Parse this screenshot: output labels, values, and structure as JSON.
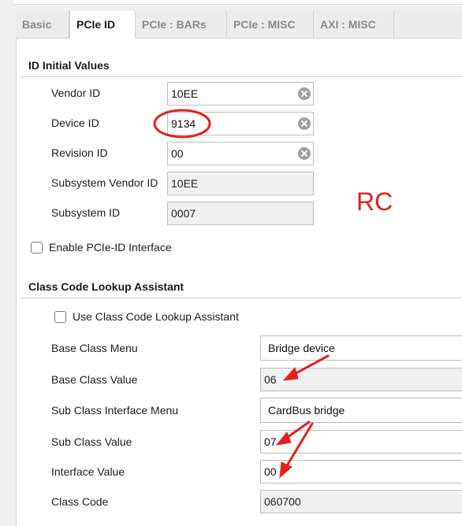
{
  "tabs": [
    {
      "label": "Basic",
      "active": false
    },
    {
      "label": "PCIe ID",
      "active": true
    },
    {
      "label": "PCIe : BARs",
      "active": false
    },
    {
      "label": "PCIe : MISC",
      "active": false
    },
    {
      "label": "AXI : MISC",
      "active": false
    }
  ],
  "id_section": {
    "title": "ID Initial Values",
    "vendor_id": {
      "label": "Vendor ID",
      "value": "10EE"
    },
    "device_id": {
      "label": "Device ID",
      "value": "9134"
    },
    "revision_id": {
      "label": "Revision ID",
      "value": "00"
    },
    "subsystem_vendor_id": {
      "label": "Subsystem Vendor ID",
      "value": "10EE"
    },
    "subsystem_id": {
      "label": "Subsystem ID",
      "value": "0007"
    },
    "enable_pcie_id": {
      "label": "Enable PCIe-ID Interface",
      "checked": false
    }
  },
  "annotation_text": "RC",
  "class_section": {
    "title": "Class Code Lookup Assistant",
    "use_assistant": {
      "label": "Use Class Code Lookup Assistant",
      "checked": false
    },
    "base_class_menu": {
      "label": "Base Class Menu",
      "value": "Bridge device"
    },
    "base_class_value": {
      "label": "Base Class Value",
      "value": "06"
    },
    "sub_class_interface_menu": {
      "label": "Sub Class Interface Menu",
      "value": "CardBus bridge"
    },
    "sub_class_value": {
      "label": "Sub Class Value",
      "value": "07"
    },
    "interface_value": {
      "label": "Interface Value",
      "value": "00"
    },
    "class_code": {
      "label": "Class Code",
      "value": "060700"
    }
  },
  "colors": {
    "annotation": "#e52020",
    "readonly_field": "#f0f0f0",
    "tab_bar": "#ececec"
  }
}
